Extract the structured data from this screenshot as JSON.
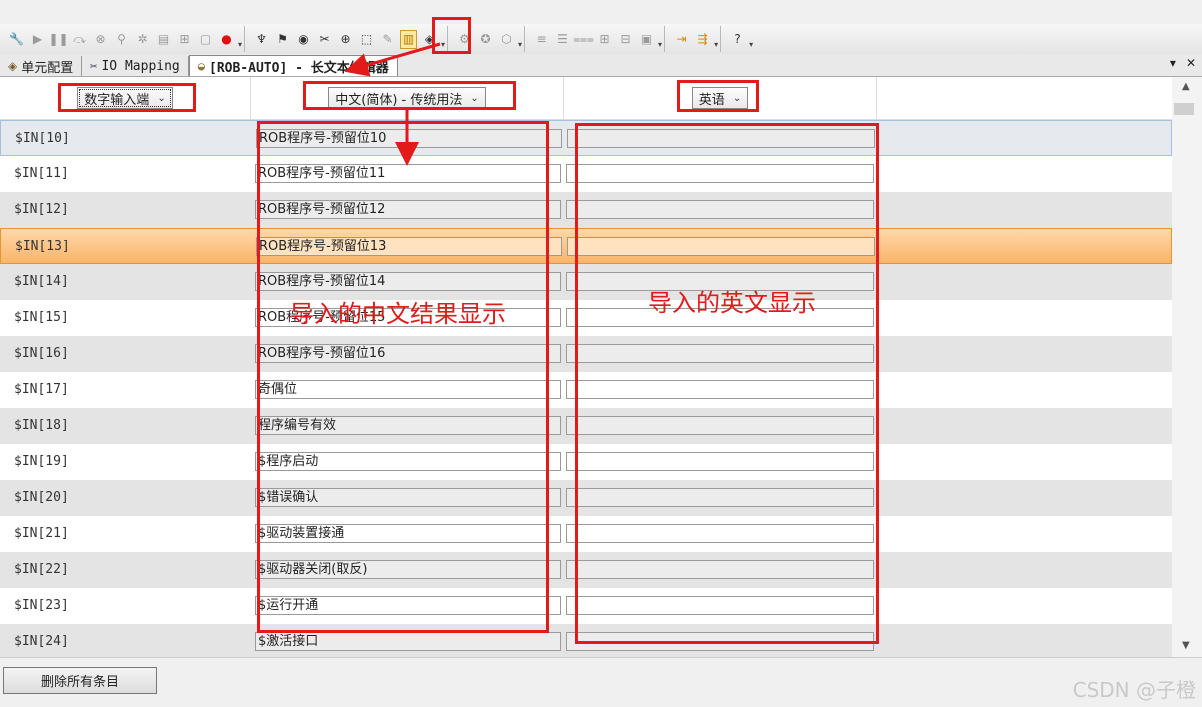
{
  "toolbar": {
    "icons": [
      "wrench-icon",
      "play-icon",
      "pause-icon",
      "step-icon",
      "stop-icon",
      "search-icon",
      "gear-icon",
      "document-icon",
      "tree-icon",
      "page-icon",
      "record-icon",
      "antenna-icon",
      "flag-icon",
      "target-icon",
      "tools-icon",
      "lock-icon",
      "compile-icon",
      "edit-icon",
      "long-text-editor-icon",
      "cube-icon",
      "gear-large-icon",
      "gear-plus-icon",
      "box-icon",
      "align-left-icon",
      "align-center-icon",
      "align-right-icon",
      "plus-icon",
      "minus-icon",
      "paste-icon",
      "import-icon",
      "export-icon",
      "help-icon"
    ]
  },
  "tabs": [
    {
      "label": "单元配置",
      "icon": "cube-icon"
    },
    {
      "label": "IO Mapping",
      "icon": "tools-icon"
    },
    {
      "label": "[ROB-AUTO] - 长文本编辑器",
      "icon": "editor-icon"
    }
  ],
  "tab_controls": {
    "dropdown": "▾",
    "close": "✕"
  },
  "columns": {
    "signal_type": "数字输入端",
    "source_language": "中文(简体) - 传统用法",
    "target_language": "英语"
  },
  "rows": [
    {
      "signal": "$IN[10]",
      "zh": "ROB程序号-预留位10",
      "en": ""
    },
    {
      "signal": "$IN[11]",
      "zh": "ROB程序号-预留位11",
      "en": ""
    },
    {
      "signal": "$IN[12]",
      "zh": "ROB程序号-预留位12",
      "en": ""
    },
    {
      "signal": "$IN[13]",
      "zh": "ROB程序号-预留位13",
      "en": ""
    },
    {
      "signal": "$IN[14]",
      "zh": "ROB程序号-预留位14",
      "en": ""
    },
    {
      "signal": "$IN[15]",
      "zh": "ROB程序号-预留位15",
      "en": ""
    },
    {
      "signal": "$IN[16]",
      "zh": "ROB程序号-预留位16",
      "en": ""
    },
    {
      "signal": "$IN[17]",
      "zh": "奇偶位",
      "en": ""
    },
    {
      "signal": "$IN[18]",
      "zh": "程序编号有效",
      "en": ""
    },
    {
      "signal": "$IN[19]",
      "zh": "$程序启动",
      "en": ""
    },
    {
      "signal": "$IN[20]",
      "zh": "$错误确认",
      "en": ""
    },
    {
      "signal": "$IN[21]",
      "zh": "$驱动装置接通",
      "en": ""
    },
    {
      "signal": "$IN[22]",
      "zh": "$驱动器关闭(取反)",
      "en": ""
    },
    {
      "signal": "$IN[23]",
      "zh": "$运行开通",
      "en": ""
    },
    {
      "signal": "$IN[24]",
      "zh": "$激活接口",
      "en": ""
    }
  ],
  "selected_row": "$IN[13]",
  "buttons": {
    "delete_all": "删除所有条目"
  },
  "annotations": {
    "zh_result": "导入的中文结果显示",
    "en_result": "导入的英文显示"
  },
  "watermark": "CSDN @子橙",
  "colors": {
    "annotation_red": "#e21a1a",
    "selected_row": "#f9b46a",
    "alt_row": "#e4e4e4"
  }
}
